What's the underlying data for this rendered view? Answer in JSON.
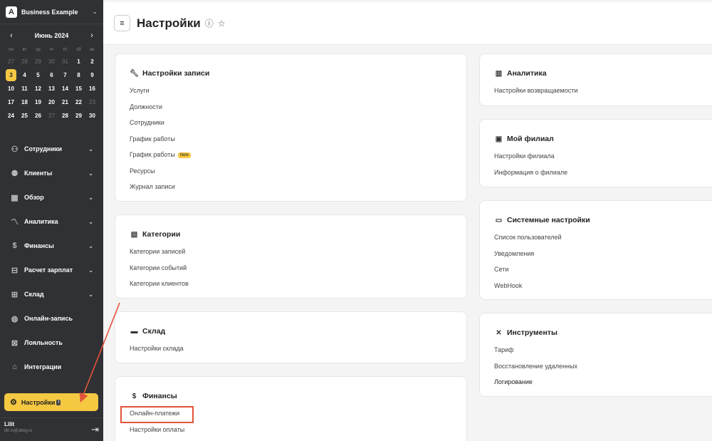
{
  "sidebar": {
    "brand": "Business Example",
    "calendar": {
      "month": "Июнь 2024",
      "weekdays": [
        "пн",
        "вт",
        "ср",
        "чт",
        "пт",
        "сб",
        "вс"
      ],
      "days": [
        {
          "d": "27",
          "m": true
        },
        {
          "d": "28",
          "m": true
        },
        {
          "d": "29",
          "m": true
        },
        {
          "d": "30",
          "m": true
        },
        {
          "d": "31",
          "m": true
        },
        {
          "d": "1"
        },
        {
          "d": "2"
        },
        {
          "d": "3",
          "t": true
        },
        {
          "d": "4"
        },
        {
          "d": "5"
        },
        {
          "d": "6"
        },
        {
          "d": "7"
        },
        {
          "d": "8"
        },
        {
          "d": "9"
        },
        {
          "d": "10"
        },
        {
          "d": "11"
        },
        {
          "d": "12"
        },
        {
          "d": "13"
        },
        {
          "d": "14"
        },
        {
          "d": "15"
        },
        {
          "d": "16"
        },
        {
          "d": "17"
        },
        {
          "d": "18"
        },
        {
          "d": "19"
        },
        {
          "d": "20"
        },
        {
          "d": "21"
        },
        {
          "d": "22"
        },
        {
          "d": "23",
          "m": true
        },
        {
          "d": "24"
        },
        {
          "d": "25"
        },
        {
          "d": "26"
        },
        {
          "d": "27",
          "m": true
        },
        {
          "d": "28"
        },
        {
          "d": "29"
        },
        {
          "d": "30"
        }
      ]
    },
    "nav": [
      {
        "label": "Сотрудники",
        "icon": "user-icon",
        "glyph": "⚇",
        "chevron": true
      },
      {
        "label": "Клиенты",
        "icon": "clients-icon",
        "glyph": "⚉",
        "chevron": true
      },
      {
        "label": "Обзор",
        "icon": "overview-icon",
        "glyph": "▦",
        "chevron": true
      },
      {
        "label": "Аналитика",
        "icon": "analytics-icon",
        "glyph": "〽",
        "chevron": true
      },
      {
        "label": "Финансы",
        "icon": "finance-icon",
        "glyph": "$",
        "chevron": true
      },
      {
        "label": "Расчет зарплат",
        "icon": "payroll-icon",
        "glyph": "⊟",
        "chevron": true
      },
      {
        "label": "Склад",
        "icon": "warehouse-icon",
        "glyph": "⊞",
        "chevron": true
      },
      {
        "label": "Онлайн-запись",
        "icon": "globe-icon",
        "glyph": "◍",
        "chevron": false
      },
      {
        "label": "Лояльность",
        "icon": "loyalty-icon",
        "glyph": "⊠",
        "chevron": false
      },
      {
        "label": "Интеграции",
        "icon": "integrations-icon",
        "glyph": "⌂",
        "chevron": false
      }
    ],
    "settings_label": "Настройки",
    "settings_badge": "!",
    "user_name": "Lilit",
    "user_email": "lilit.m@alteg.io"
  },
  "header": {
    "title": "Настройки"
  },
  "cards": {
    "booking": {
      "title": "Настройки записи",
      "links": [
        "Услуги",
        "Должности",
        "Сотрудники",
        "График работы",
        "График работы",
        "Ресурсы",
        "Журнал записи"
      ],
      "new_badge": "New"
    },
    "categories": {
      "title": "Категории",
      "links": [
        "Категории записей",
        "Категории событий",
        "Категории клиентов"
      ]
    },
    "warehouse": {
      "title": "Склад",
      "links": [
        "Настройки склада"
      ]
    },
    "finance": {
      "title": "Финансы",
      "links": [
        "Онлайн-платежи",
        "Настройки оплаты"
      ]
    },
    "analytics": {
      "title": "Аналитика",
      "links": [
        "Настройки возвращаемости"
      ]
    },
    "branch": {
      "title": "Мой филиал",
      "links": [
        "Настройки филиала",
        "Информация о филиале"
      ]
    },
    "system": {
      "title": "Системные настройки",
      "links": [
        "Список пользователей",
        "Уведомления",
        "Сети",
        "WebHook"
      ]
    },
    "tools": {
      "title": "Инструменты",
      "links": [
        "Тариф",
        "Восстановление удаленных",
        "Логирование"
      ]
    }
  },
  "colors": {
    "accent": "#f5c842",
    "sidebar": "#2f3134",
    "annotation": "#e2533a"
  }
}
